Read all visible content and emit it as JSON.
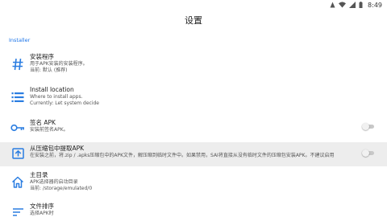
{
  "status_bar": {
    "time": "8:49",
    "icons": [
      "notification-icon",
      "wifi-icon",
      "signal-icon",
      "battery-icon"
    ]
  },
  "app_bar": {
    "title": "设置"
  },
  "section": {
    "label": "Installer"
  },
  "items": [
    {
      "title": "安装程序",
      "lines": [
        "用于APK安装的安装程序。",
        "当前: 默认 (推荐)"
      ],
      "icon": "hash-icon"
    },
    {
      "title": "Install location",
      "lines": [
        "Where to install apps.",
        "Currently: Let system decide"
      ],
      "icon": "list-icon"
    },
    {
      "title": "签名 APK",
      "lines": [
        "安装前签名APK。"
      ],
      "icon": "key-icon",
      "toggle": "off"
    },
    {
      "title": "从压缩包中提取APK",
      "lines": [
        "在安装之前，将.zip / .apks压缩包中的APK文件，解压缩到临时文件中。如果禁用，SAI将直接从没有临时文件的压缩包安装APK。不建议启用"
      ],
      "icon": "archive-extract-icon",
      "toggle": "off"
    },
    {
      "title": "主目录",
      "lines": [
        "APK选择器的启动目录",
        "当前: /storage/emulated/0"
      ],
      "icon": "home-icon"
    },
    {
      "title": "文件排序",
      "lines": [
        "选择APK时"
      ],
      "icon": "sort-icon"
    }
  ],
  "colors": {
    "accent": "#1a73e8",
    "icon": "#2a7de1",
    "highlight_row": "#ededed"
  }
}
